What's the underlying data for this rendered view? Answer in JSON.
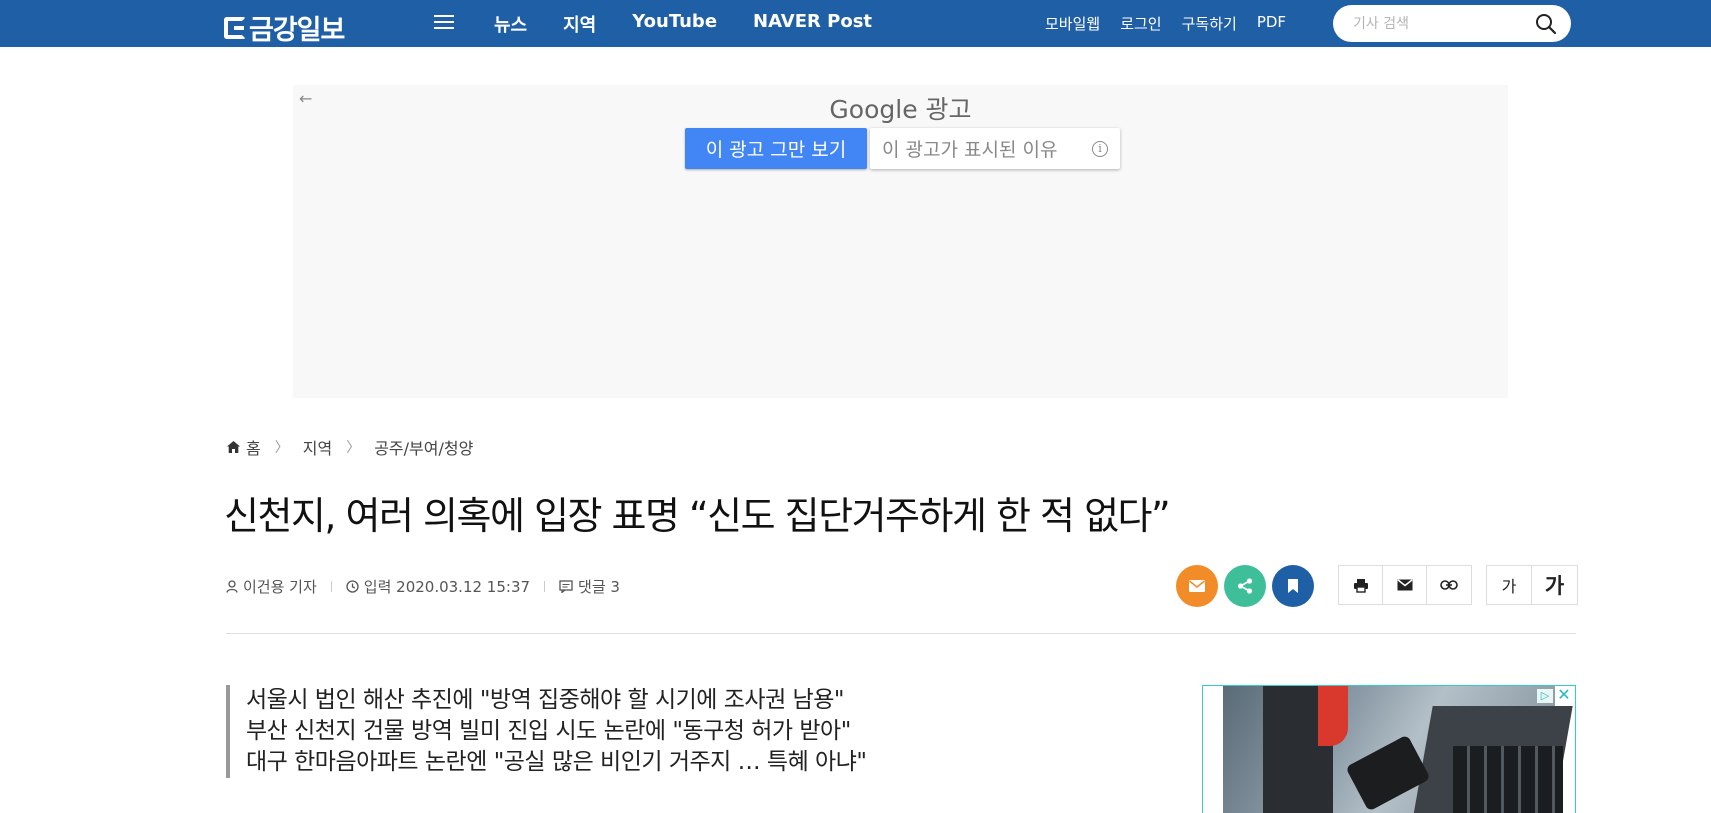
{
  "header": {
    "logo": "금강일보",
    "nav": [
      "뉴스",
      "지역",
      "YouTube",
      "NAVER Post"
    ],
    "util_links": [
      "모바일웹",
      "로그인",
      "구독하기",
      "PDF"
    ],
    "search_placeholder": "기사 검색",
    "brand_color": "#1f5fa6"
  },
  "ad": {
    "provider": "Google",
    "label": "광고",
    "stop_button": "이 광고 그만 보기",
    "why_button": "이 광고가 표시된 이유"
  },
  "breadcrumb": [
    "홈",
    "지역",
    "공주/부여/청양"
  ],
  "article": {
    "title": "신천지, 여러 의혹에 입장 표명 “신도 집단거주하게 한 적 없다”",
    "author": "이건용 기자",
    "date": "입력 2020.03.12 15:37",
    "comments": "댓글 3",
    "summary": [
      "서울시 법인 해산 추진에 \"방역 집중해야 할 시기에 조사권 남용\"",
      "부산 신천지 건물 방역 빌미 진입 시도 논란에 \"동구청 허가 받아\"",
      "대구 한마음아파트 논란엔 \"공실 많은 비인기 거주지 … 특혜 아냐\""
    ]
  },
  "tools": {
    "font_small": "가",
    "font_large": "가",
    "share_colors": {
      "mail": "#f28c28",
      "share": "#3ebf9a",
      "bookmark": "#1f5fa6"
    }
  }
}
